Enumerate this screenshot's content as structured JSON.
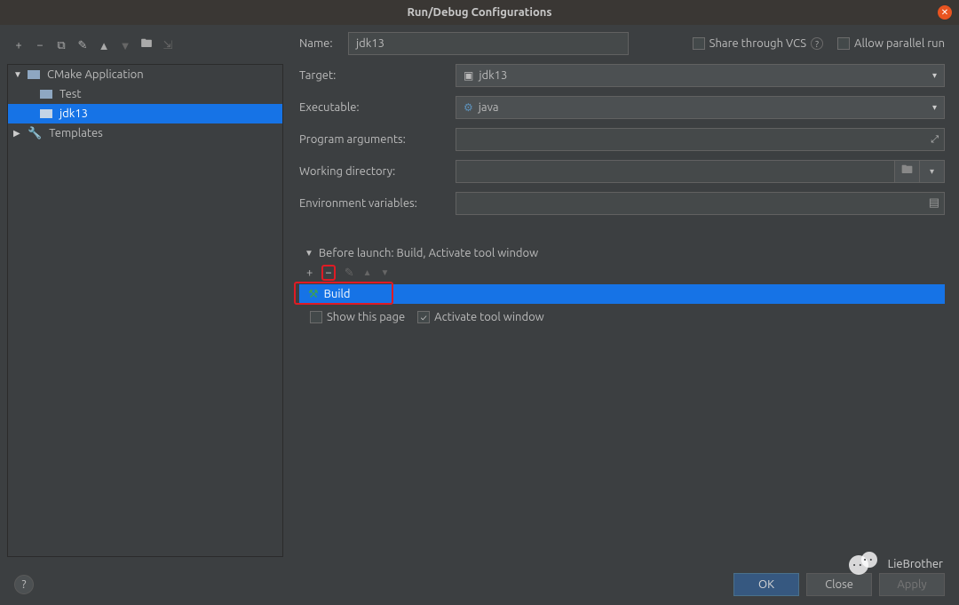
{
  "window": {
    "title": "Run/Debug Configurations"
  },
  "sidebar": {
    "group_label": "CMake Application",
    "items": [
      "Test",
      "jdk13"
    ],
    "selected_index": 1,
    "templates_label": "Templates"
  },
  "form": {
    "name": {
      "label": "Name:",
      "value": "jdk13"
    },
    "share_label": "Share through VCS",
    "parallel_label": "Allow parallel run",
    "target": {
      "label": "Target:",
      "value": "jdk13"
    },
    "executable": {
      "label": "Executable:",
      "value": "java"
    },
    "program_args": {
      "label": "Program arguments:",
      "value": ""
    },
    "working_dir": {
      "label": "Working directory:",
      "value": ""
    },
    "env": {
      "label": "Environment variables:",
      "value": ""
    }
  },
  "before_launch": {
    "header": "Before launch: Build, Activate tool window",
    "tasks": [
      "Build"
    ],
    "show_page_label": "Show this page",
    "activate_label": "Activate tool window",
    "activate_checked": true
  },
  "footer": {
    "ok": "OK",
    "close": "Close",
    "apply": "Apply"
  },
  "watermark": "LieBrother"
}
